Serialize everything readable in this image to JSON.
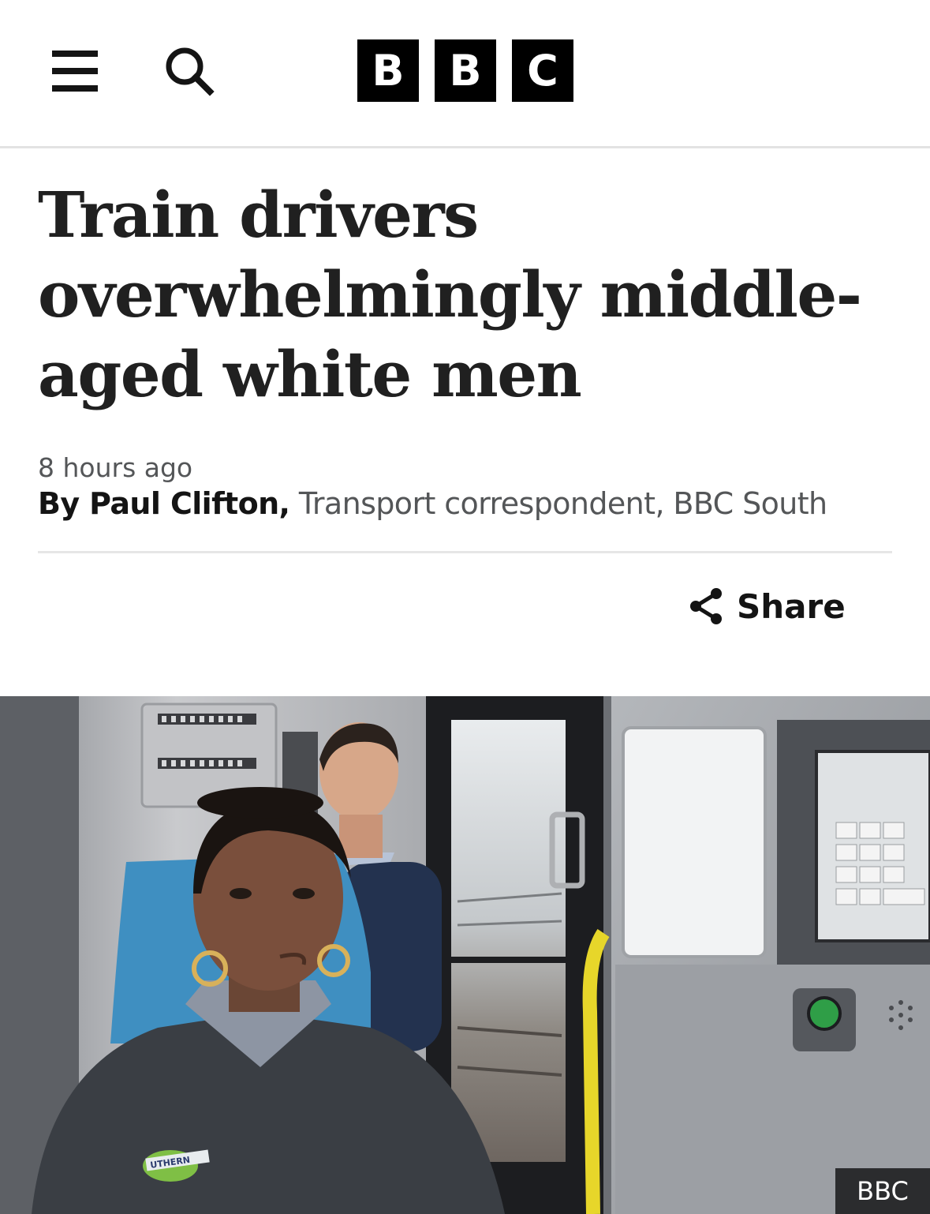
{
  "header": {
    "logo_letters": [
      "B",
      "B",
      "C"
    ]
  },
  "article": {
    "headline": "Train drivers overwhelmingly middle-aged white men",
    "timestamp": "8 hours ago",
    "byline_author": "By Paul Clifton,",
    "byline_role": " Transport correspondent, BBC South",
    "share_label": "Share"
  },
  "hero_image": {
    "credit": "BBC",
    "badge_text": "UTHERN"
  },
  "icons": {
    "menu": "hamburger-menu-icon",
    "search": "search-icon",
    "share": "share-icon"
  },
  "colors": {
    "logo_bg": "#000000",
    "text_primary": "#141414",
    "text_secondary": "#545658",
    "divider": "#e6e6e6"
  }
}
